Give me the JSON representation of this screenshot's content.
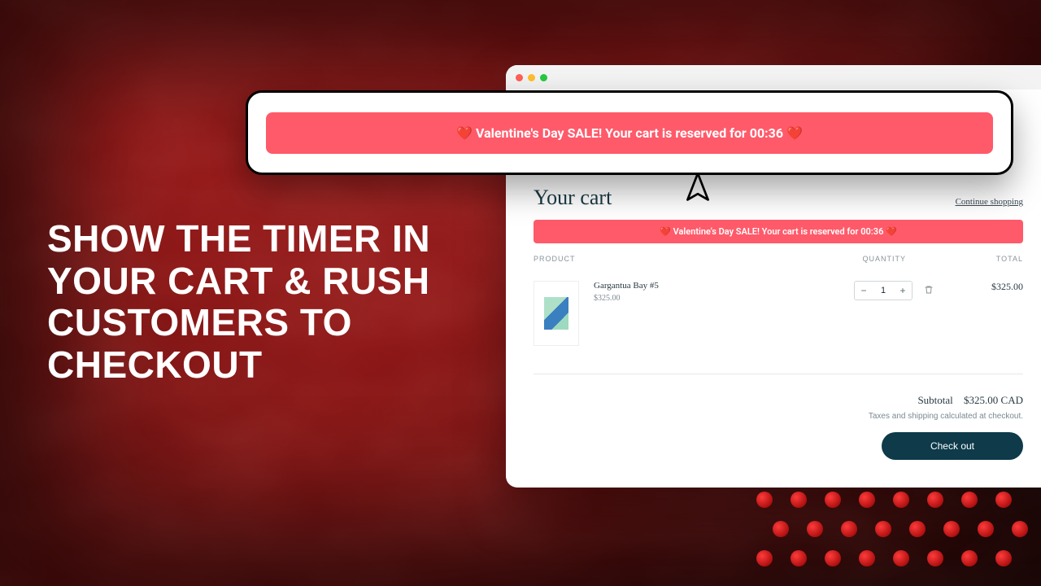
{
  "headline": "SHOW THE TIMER IN YOUR CART  & RUSH CUSTOMERS TO CHECKOUT",
  "banner": {
    "big": "❤️ Valentine's Day SALE! Your cart is reserved for 00:36 ❤️",
    "small": "❤️ Valentine's Day SALE! Your cart is reserved for 00:36 ❤️",
    "color": "#ff5a6a"
  },
  "cart": {
    "title": "Your cart",
    "continue": "Continue shopping",
    "columns": {
      "product": "PRODUCT",
      "quantity": "QUANTITY",
      "total": "TOTAL"
    },
    "item": {
      "name": "Gargantua Bay #5",
      "price": "$325.00",
      "qty": "1",
      "lineTotal": "$325.00"
    },
    "subtotal": {
      "label": "Subtotal",
      "value": "$325.00 CAD"
    },
    "note": "Taxes and shipping calculated at checkout.",
    "checkout": "Check out"
  },
  "qty": {
    "minus": "−",
    "plus": "+"
  }
}
